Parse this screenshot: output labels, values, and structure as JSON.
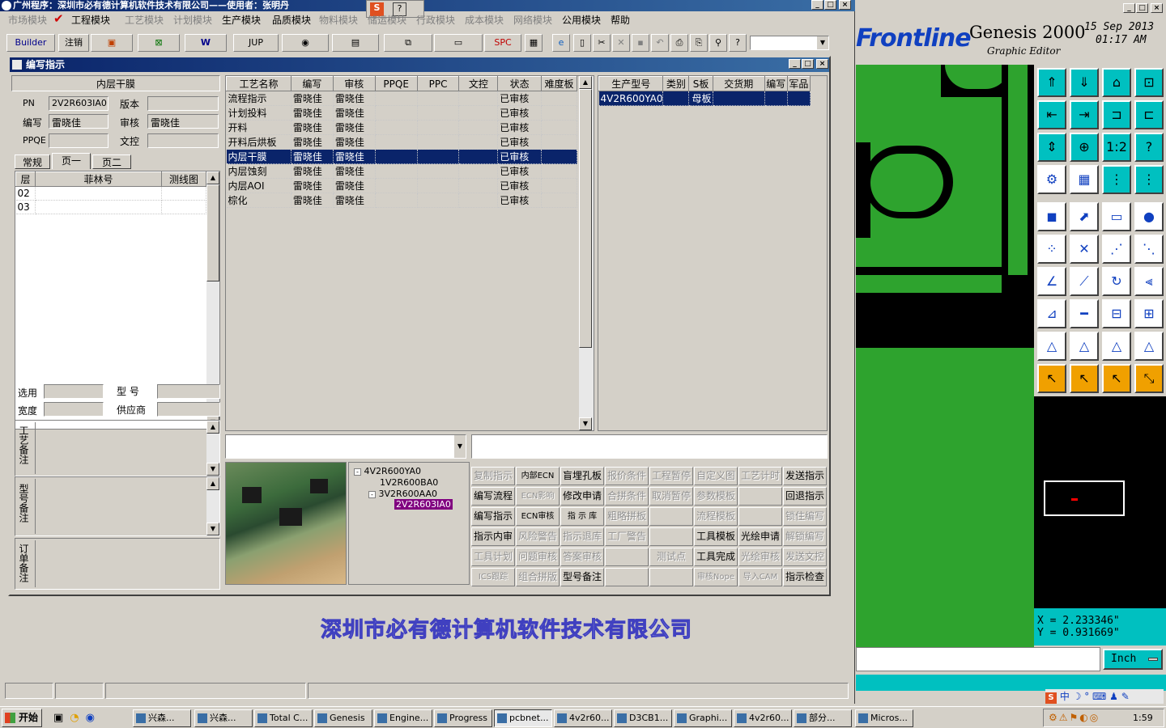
{
  "main_window": {
    "title": "广州程序：深圳市必有德计算机软件技术有限公司——使用者：张明丹",
    "menu": [
      {
        "label": "市场模块",
        "enabled": false
      },
      {
        "label": "工程模块",
        "enabled": true
      },
      {
        "label": "工艺模块",
        "enabled": false
      },
      {
        "label": "计划模块",
        "enabled": false
      },
      {
        "label": "生产模块",
        "enabled": true
      },
      {
        "label": "品质模块",
        "enabled": true
      },
      {
        "label": "物料模块",
        "enabled": false
      },
      {
        "label": "储运模块",
        "enabled": false
      },
      {
        "label": "行政模块",
        "enabled": false
      },
      {
        "label": "成本模块",
        "enabled": false
      },
      {
        "label": "网络模块",
        "enabled": false
      },
      {
        "label": "公用模块",
        "enabled": true
      },
      {
        "label": "帮助",
        "enabled": true
      }
    ],
    "toolbar": {
      "builder": "Builder",
      "cancel": "注销",
      "jup": "JUP",
      "spc": "SPC"
    }
  },
  "dialog": {
    "title": "编写指示",
    "left": {
      "header": "内层干膜",
      "pn_label": "PN",
      "pn": "2V2R603IA0",
      "version_label": "版本",
      "version": "",
      "writer_label": "编写",
      "writer": "雷晓佳",
      "review_label": "审核",
      "review": "雷晓佳",
      "ppqe_label": "PPQE",
      "ppqe": "",
      "wencontrol_label": "文控",
      "wencontrol": "",
      "tabs": [
        "常规",
        "页一",
        "页二"
      ],
      "layer_cols": [
        "层",
        "菲林号",
        "测线图"
      ],
      "layers": [
        [
          "02",
          "",
          ""
        ],
        [
          "03",
          "",
          ""
        ]
      ],
      "select_label": "选用",
      "select": "",
      "model_label": "型  号",
      "model": "",
      "width_label": "宽度",
      "width": "",
      "supplier_label": "供应商",
      "supplier": "",
      "note_labels": [
        "工艺备注",
        "型号备注",
        "订单备注"
      ]
    },
    "process": {
      "cols": [
        "工艺名称",
        "编写",
        "审核",
        "PPQE",
        "PPC",
        "文控",
        "状态",
        "难度板"
      ],
      "rows": [
        [
          "流程指示",
          "雷晓佳",
          "雷晓佳",
          "",
          "",
          "",
          "已审核",
          ""
        ],
        [
          "计划投料",
          "雷晓佳",
          "雷晓佳",
          "",
          "",
          "",
          "已审核",
          ""
        ],
        [
          "开料",
          "雷晓佳",
          "雷晓佳",
          "",
          "",
          "",
          "已审核",
          ""
        ],
        [
          "开料后烘板",
          "雷晓佳",
          "雷晓佳",
          "",
          "",
          "",
          "已审核",
          ""
        ],
        [
          "内层干膜",
          "雷晓佳",
          "雷晓佳",
          "",
          "",
          "",
          "已审核",
          ""
        ],
        [
          "内层蚀刻",
          "雷晓佳",
          "雷晓佳",
          "",
          "",
          "",
          "已审核",
          ""
        ],
        [
          "内层AOI",
          "雷晓佳",
          "雷晓佳",
          "",
          "",
          "",
          "已审核",
          ""
        ],
        [
          "棕化",
          "雷晓佳",
          "雷晓佳",
          "",
          "",
          "",
          "已审核",
          ""
        ]
      ]
    },
    "product": {
      "cols": [
        "生产型号",
        "类别",
        "S板",
        "交货期",
        "编写",
        "军品"
      ],
      "rows": [
        [
          "4V2R600YA0",
          "",
          "母板",
          "",
          "",
          ""
        ]
      ]
    },
    "tree": [
      "4V2R600YA0",
      "1V2R600BA0",
      "3V2R600AA0",
      "2V2R603IA0"
    ],
    "buttons": [
      [
        "复制指示",
        "内部ECN",
        "盲埋孔板",
        "报价条件",
        "工程暂停",
        "自定义图",
        "工艺计时",
        "发送指示"
      ],
      [
        "编写流程",
        "ECN影响",
        "修改申请",
        "合拼条件",
        "取消暂停",
        "参数模板",
        "",
        "回退指示"
      ],
      [
        "编写指示",
        "ECN审核",
        "指 示 库",
        "粗略拼板",
        "",
        "流程模板",
        "",
        "锁住编写"
      ],
      [
        "指示内审",
        "风险警告",
        "指示退库",
        "工厂警告",
        "",
        "工具模板",
        "光绘申请",
        "解锁编写"
      ],
      [
        "工具计划",
        "问题审核",
        "答案审核",
        "",
        "测试点",
        "工具完成",
        "光绘审核",
        "发送文控"
      ],
      [
        "ICS跟踪",
        "组合拼版",
        "型号备注",
        "",
        "",
        "审核Nope",
        "导入CAM",
        "指示检查"
      ]
    ],
    "buttons_enabled": [
      [
        0,
        1,
        1,
        0,
        0,
        0,
        0,
        1
      ],
      [
        1,
        0,
        1,
        0,
        0,
        0,
        0,
        1
      ],
      [
        1,
        1,
        1,
        0,
        0,
        0,
        0,
        0
      ],
      [
        1,
        0,
        0,
        0,
        0,
        1,
        1,
        0
      ],
      [
        0,
        0,
        0,
        0,
        0,
        1,
        0,
        0
      ],
      [
        0,
        0,
        1,
        0,
        0,
        0,
        0,
        1
      ]
    ]
  },
  "watermark": "深圳市必有德计算机软件技术有限公司",
  "genesis": {
    "brand": "Frontline",
    "product": "Genesis 2000",
    "subtitle": "Graphic Editor",
    "date": "15 Sep 2013",
    "time": "01:17 AM",
    "x_readout": "X = 2.233346\"",
    "y_readout": "Y = 0.931669\"",
    "unit": "Inch"
  },
  "taskbar": {
    "start": "开始",
    "tasks": [
      "兴森...",
      "兴森...",
      "Total C...",
      "Genesis",
      "Engine...",
      "Progress",
      "pcbnet...",
      "4v2r60...",
      "D3CB1...",
      "Graphi...",
      "4v2r60...",
      "部分...",
      "Micros..."
    ],
    "clock": "1:59"
  }
}
